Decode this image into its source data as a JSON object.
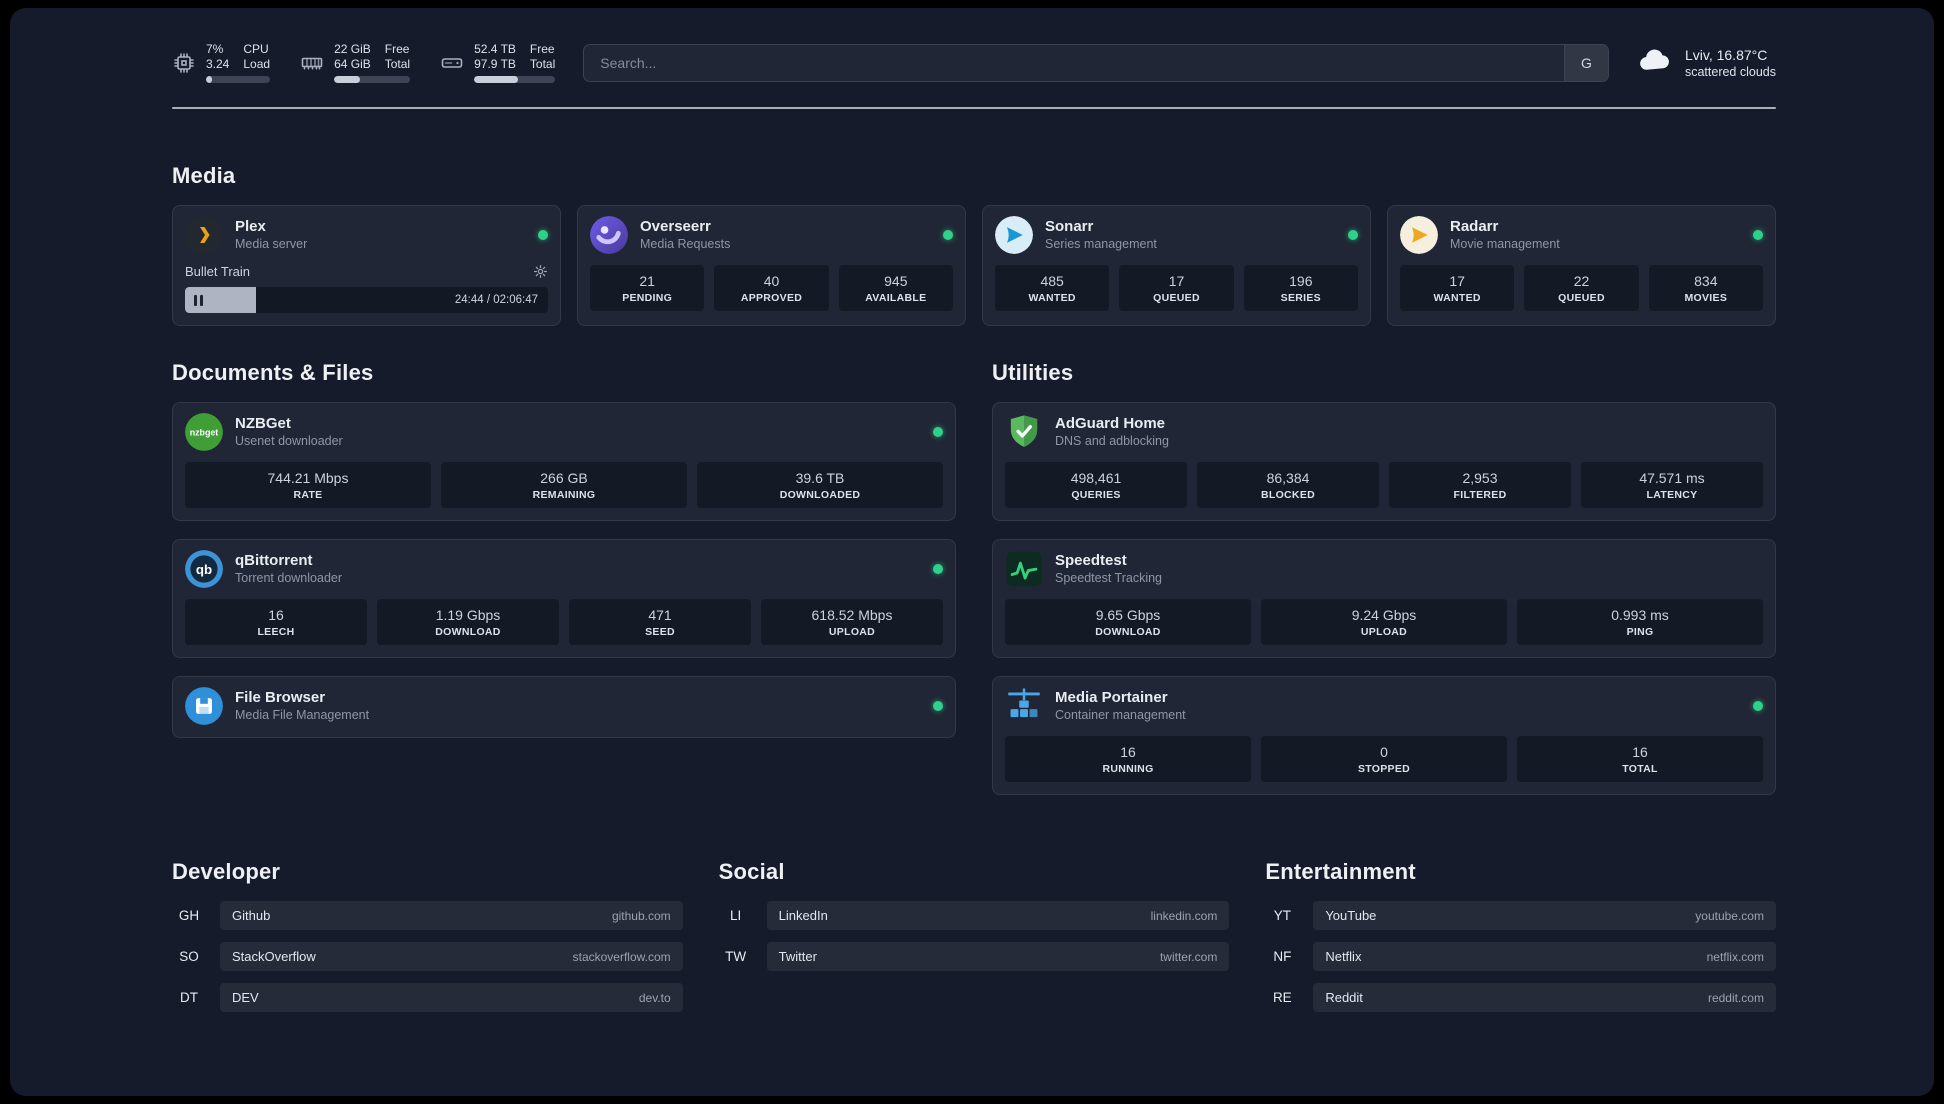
{
  "topbar": {
    "cpu": {
      "rows": [
        {
          "value": "7%",
          "label": "CPU"
        },
        {
          "value": "3.24",
          "label": "Load"
        }
      ],
      "bar_pct": 10
    },
    "memory": {
      "rows": [
        {
          "value": "22 GiB",
          "label": "Free"
        },
        {
          "value": "64 GiB",
          "label": "Total"
        }
      ],
      "bar_pct": 34
    },
    "disk": {
      "rows": [
        {
          "value": "52.4 TB",
          "label": "Free"
        },
        {
          "value": "97.9 TB",
          "label": "Total"
        }
      ],
      "bar_pct": 54
    },
    "search": {
      "placeholder": "Search...",
      "provider_button": "G"
    },
    "weather": {
      "location": "Lviv, 16.87°C",
      "condition": "scattered clouds"
    }
  },
  "icon_badges": {
    "nzbget": "nzbget",
    "qbittorrent": "qb"
  },
  "colors": {
    "status_online": "#2fd18a",
    "plex_accent": "#e5a00d",
    "background": "#151b2b"
  },
  "sections": {
    "media": {
      "title": "Media",
      "cards": [
        {
          "name": "Plex",
          "subtitle": "Media server",
          "online": true,
          "player": {
            "track": "Bullet Train",
            "time": "24:44 / 02:06:47",
            "progress_pct": 19.5
          }
        },
        {
          "name": "Overseerr",
          "subtitle": "Media Requests",
          "online": true,
          "stats": [
            {
              "value": "21",
              "label": "PENDING"
            },
            {
              "value": "40",
              "label": "APPROVED"
            },
            {
              "value": "945",
              "label": "AVAILABLE"
            }
          ]
        },
        {
          "name": "Sonarr",
          "subtitle": "Series management",
          "online": true,
          "stats": [
            {
              "value": "485",
              "label": "WANTED"
            },
            {
              "value": "17",
              "label": "QUEUED"
            },
            {
              "value": "196",
              "label": "SERIES"
            }
          ]
        },
        {
          "name": "Radarr",
          "subtitle": "Movie management",
          "online": true,
          "stats": [
            {
              "value": "17",
              "label": "WANTED"
            },
            {
              "value": "22",
              "label": "QUEUED"
            },
            {
              "value": "834",
              "label": "MOVIES"
            }
          ]
        }
      ]
    },
    "documents": {
      "title": "Documents & Files",
      "cards": [
        {
          "name": "NZBGet",
          "subtitle": "Usenet downloader",
          "online": true,
          "stats": [
            {
              "value": "744.21 Mbps",
              "label": "RATE"
            },
            {
              "value": "266 GB",
              "label": "REMAINING"
            },
            {
              "value": "39.6 TB",
              "label": "DOWNLOADED"
            }
          ]
        },
        {
          "name": "qBittorrent",
          "subtitle": "Torrent downloader",
          "online": true,
          "stats": [
            {
              "value": "16",
              "label": "LEECH"
            },
            {
              "value": "1.19 Gbps",
              "label": "DOWNLOAD"
            },
            {
              "value": "471",
              "label": "SEED"
            },
            {
              "value": "618.52 Mbps",
              "label": "UPLOAD"
            }
          ]
        },
        {
          "name": "File Browser",
          "subtitle": "Media File Management",
          "online": true,
          "stats": []
        }
      ]
    },
    "utilities": {
      "title": "Utilities",
      "cards": [
        {
          "name": "AdGuard Home",
          "subtitle": "DNS and adblocking",
          "online": false,
          "stats": [
            {
              "value": "498,461",
              "label": "QUERIES"
            },
            {
              "value": "86,384",
              "label": "BLOCKED"
            },
            {
              "value": "2,953",
              "label": "FILTERED"
            },
            {
              "value": "47.571 ms",
              "label": "LATENCY"
            }
          ]
        },
        {
          "name": "Speedtest",
          "subtitle": "Speedtest Tracking",
          "online": false,
          "stats": [
            {
              "value": "9.65 Gbps",
              "label": "DOWNLOAD"
            },
            {
              "value": "9.24 Gbps",
              "label": "UPLOAD"
            },
            {
              "value": "0.993 ms",
              "label": "PING"
            }
          ]
        },
        {
          "name": "Media Portainer",
          "subtitle": "Container management",
          "online": true,
          "stats": [
            {
              "value": "16",
              "label": "RUNNING"
            },
            {
              "value": "0",
              "label": "STOPPED"
            },
            {
              "value": "16",
              "label": "TOTAL"
            }
          ]
        }
      ]
    },
    "developer": {
      "title": "Developer",
      "bookmarks": [
        {
          "abbr": "GH",
          "name": "Github",
          "domain": "github.com"
        },
        {
          "abbr": "SO",
          "name": "StackOverflow",
          "domain": "stackoverflow.com"
        },
        {
          "abbr": "DT",
          "name": "DEV",
          "domain": "dev.to"
        }
      ]
    },
    "social": {
      "title": "Social",
      "bookmarks": [
        {
          "abbr": "LI",
          "name": "LinkedIn",
          "domain": "linkedin.com"
        },
        {
          "abbr": "TW",
          "name": "Twitter",
          "domain": "twitter.com"
        }
      ]
    },
    "entertainment": {
      "title": "Entertainment",
      "bookmarks": [
        {
          "abbr": "YT",
          "name": "YouTube",
          "domain": "youtube.com"
        },
        {
          "abbr": "NF",
          "name": "Netflix",
          "domain": "netflix.com"
        },
        {
          "abbr": "RE",
          "name": "Reddit",
          "domain": "reddit.com"
        }
      ]
    }
  }
}
